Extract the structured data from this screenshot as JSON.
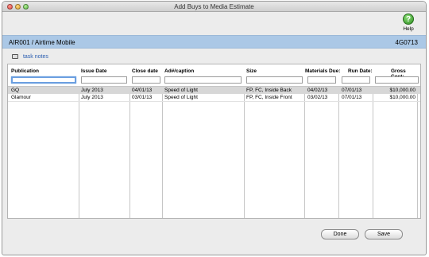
{
  "window": {
    "title": "Add Buys to Media Estimate"
  },
  "toolbar": {
    "help_label": "Help",
    "help_icon": "help-question-icon"
  },
  "estimate": {
    "name": "AIR001 / Airtime Mobile",
    "code": "4G0713"
  },
  "task_notes": {
    "label": "task notes",
    "icon": "folder-icon"
  },
  "table": {
    "columns": [
      "Publication",
      "Issue Date",
      "Close date",
      "Ad#/caption",
      "Size",
      "Materials Due:",
      "Run Date:",
      "Gross Cost:"
    ],
    "rows": [
      [
        "GQ",
        "July 2013",
        "04/01/13",
        "Speed of Light",
        "FP, FC, Inside Back",
        "04/02/13",
        "07/01/13",
        "$10,000.00"
      ],
      [
        "Glamour",
        "July 2013",
        "03/01/13",
        "Speed of Light",
        "FP, FC, Inside Front",
        "03/02/13",
        "07/01/13",
        "$10,000.00"
      ]
    ]
  },
  "buttons": {
    "done": "Done",
    "save": "Save"
  },
  "colors": {
    "header_bar": "#abc8e6",
    "selected_row": "#d7d7d7",
    "link": "#2a5db0"
  }
}
